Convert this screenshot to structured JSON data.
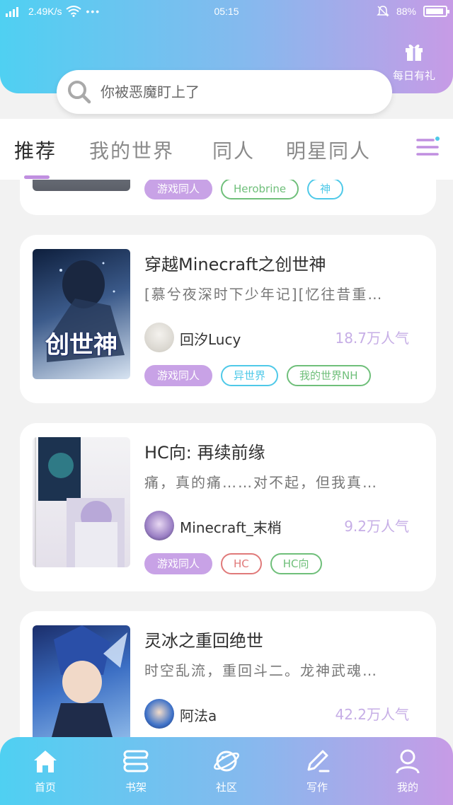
{
  "status_bar": {
    "network": "2.49K/s",
    "time": "05:15",
    "battery": "88%"
  },
  "header": {
    "gift_label": "每日有礼",
    "search_placeholder": "你被恶魔盯上了"
  },
  "tabs": [
    {
      "label": "推荐",
      "active": true
    },
    {
      "label": "我的世界",
      "active": false
    },
    {
      "label": "同人",
      "active": false
    },
    {
      "label": "明星同人",
      "active": false
    }
  ],
  "partial_card": {
    "tags": [
      {
        "label": "游戏同人",
        "style": "filled"
      },
      {
        "label": "Herobrine",
        "style": "green"
      },
      {
        "label": "神",
        "style": "blue"
      }
    ]
  },
  "books": [
    {
      "title": "穿越Minecraft之创世神",
      "description": "[慕兮夜深时下少年记][忆往昔重…",
      "author": "回汐Lucy",
      "popularity": "18.7万人气",
      "cover_text": "创世神",
      "tags": [
        {
          "label": "游戏同人",
          "style": "filled"
        },
        {
          "label": "异世界",
          "style": "blue"
        },
        {
          "label": "我的世界NH",
          "style": "green"
        }
      ]
    },
    {
      "title": "HC向: 再续前缘",
      "description": "痛，真的痛……对不起，但我真…",
      "author": "Minecraft_末梢",
      "popularity": "9.2万人气",
      "cover_text": "",
      "tags": [
        {
          "label": "游戏同人",
          "style": "filled"
        },
        {
          "label": "HC",
          "style": "red"
        },
        {
          "label": "HC向",
          "style": "green"
        }
      ]
    },
    {
      "title": "灵冰之重回绝世",
      "description": "时空乱流，重回斗二。龙神武魂…",
      "author": "阿法a",
      "popularity": "42.2万人气",
      "cover_text": "",
      "tags": []
    }
  ],
  "bottom_nav": [
    {
      "label": "首页",
      "icon": "home-icon"
    },
    {
      "label": "书架",
      "icon": "bookshelf-icon"
    },
    {
      "label": "社区",
      "icon": "planet-icon"
    },
    {
      "label": "写作",
      "icon": "pencil-icon"
    },
    {
      "label": "我的",
      "icon": "user-icon"
    }
  ],
  "colors": {
    "gradient_start": "#4fd0f2",
    "gradient_end": "#c79be6",
    "tag_filled": "#c8a2e6",
    "tag_green": "#6fbf7a",
    "tag_blue": "#4fc9e8",
    "tag_red": "#e07a7a",
    "popularity": "#c6aee6"
  }
}
